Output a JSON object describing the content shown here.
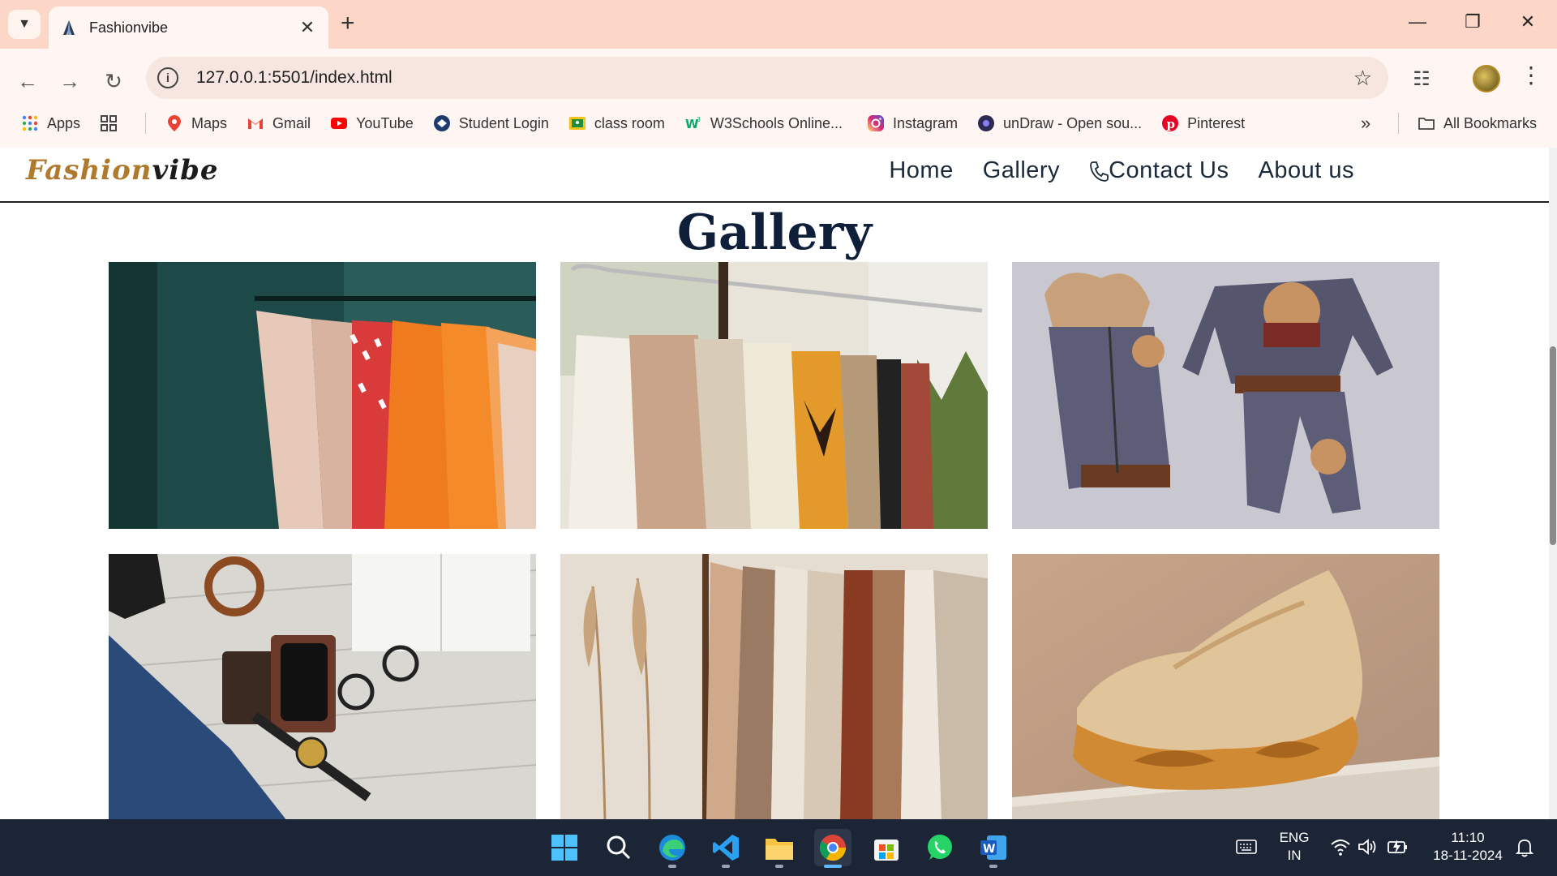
{
  "browser": {
    "tab_title": "Fashionvibe",
    "url": "127.0.0.1:5501/index.html",
    "bookmarks": [
      {
        "label": "Apps",
        "icon": "apps-grid-icon"
      },
      {
        "label": "Maps",
        "icon": "maps-icon"
      },
      {
        "label": "Gmail",
        "icon": "gmail-icon"
      },
      {
        "label": "YouTube",
        "icon": "youtube-icon"
      },
      {
        "label": "Student Login",
        "icon": "student-login-icon"
      },
      {
        "label": "class room",
        "icon": "classroom-icon"
      },
      {
        "label": "W3Schools Online...",
        "icon": "w3schools-icon"
      },
      {
        "label": "Instagram",
        "icon": "instagram-icon"
      },
      {
        "label": "unDraw - Open sou...",
        "icon": "undraw-icon"
      },
      {
        "label": "Pinterest",
        "icon": "pinterest-icon"
      }
    ],
    "all_bookmarks": "All Bookmarks"
  },
  "site": {
    "logo_part1": "Fashion",
    "logo_part2": "vibe",
    "nav": {
      "home": "Home",
      "gallery": "Gallery",
      "contact": "Contact Us",
      "about": "About us"
    },
    "gallery_title": "Gallery",
    "images": [
      {
        "subject": "clothing-rack-orange-pink-photo"
      },
      {
        "subject": "clothing-rack-neutral-blouses-photo"
      },
      {
        "subject": "kids-teddy-bear-outfit-photo"
      },
      {
        "subject": "mens-accessories-flatlay-photo"
      },
      {
        "subject": "knitwear-rack-pampas-photo"
      },
      {
        "subject": "beige-sneaker-photo"
      }
    ]
  },
  "taskbar": {
    "lang_line1": "ENG",
    "lang_line2": "IN",
    "time": "11:10",
    "date": "18-11-2024"
  },
  "colors": {
    "tabstrip": "#fcd6c6",
    "toolbar": "#fff5f2",
    "logo_accent": "#b07a2e",
    "title": "#0f1f3a",
    "taskbar": "#1b2536"
  }
}
